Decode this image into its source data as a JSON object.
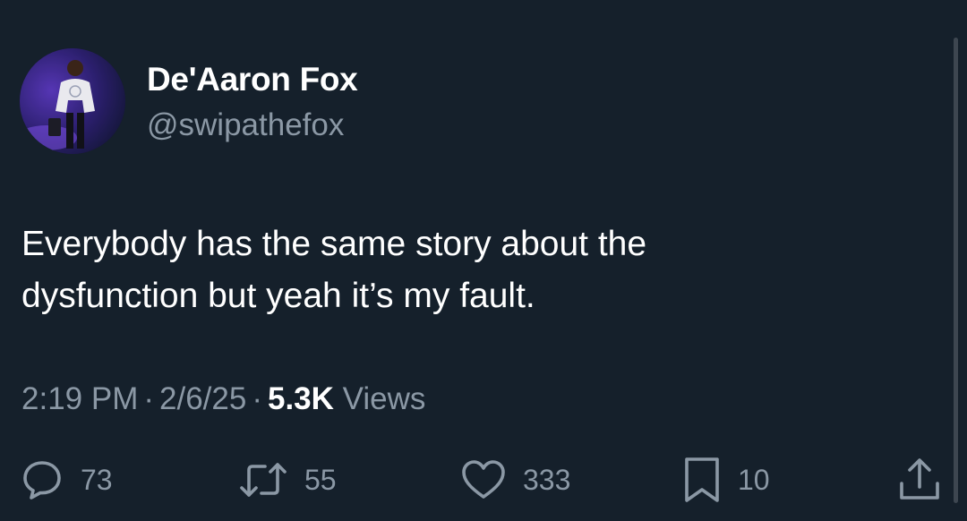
{
  "author": {
    "display_name": "De'Aaron Fox",
    "handle": "@swipathefox"
  },
  "tweet": {
    "text_lines": [
      "Everybody has the same story about the",
      "dysfunction but yeah it’s my fault."
    ],
    "time": "2:19 PM",
    "date": "2/6/25",
    "views_count": "5.3K",
    "views_label": "Views"
  },
  "actions": {
    "replies": "73",
    "reposts": "55",
    "likes": "333",
    "bookmarks": "10"
  },
  "icons": {
    "reply": "reply-icon",
    "repost": "repost-icon",
    "like": "heart-icon",
    "bookmark": "bookmark-icon",
    "share": "share-icon"
  },
  "colors": {
    "background": "#15202b",
    "primary_text": "#ffffff",
    "secondary_text": "#8b98a5"
  }
}
